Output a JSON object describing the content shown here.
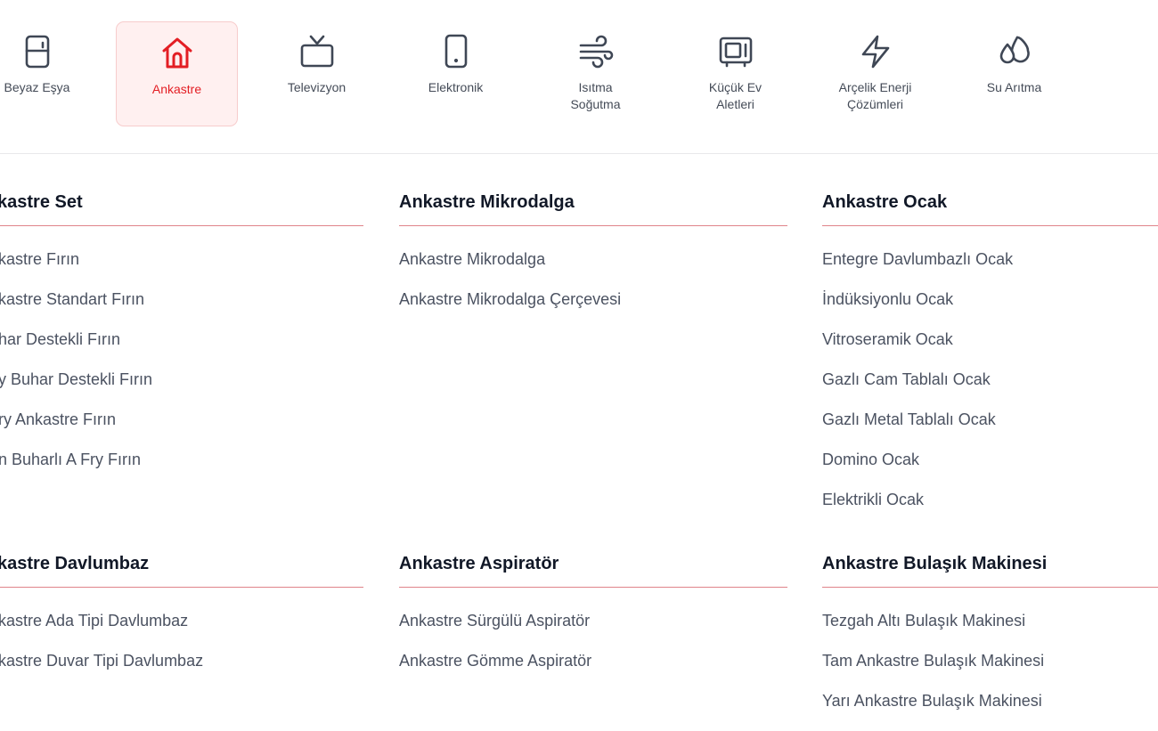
{
  "categories": [
    {
      "label": "Beyaz Eşya",
      "label2": "",
      "icon": "fridge-icon"
    },
    {
      "label": "Ankastre",
      "label2": "",
      "icon": "home-icon"
    },
    {
      "label": "Televizyon",
      "label2": "",
      "icon": "tv-icon"
    },
    {
      "label": "Elektronik",
      "label2": "",
      "icon": "phone-icon"
    },
    {
      "label": "Isıtma",
      "label2": "Soğutma",
      "icon": "wind-icon"
    },
    {
      "label": "Küçük Ev",
      "label2": "Aletleri",
      "icon": "microwave-icon"
    },
    {
      "label": "Arçelik Enerji",
      "label2": "Çözümleri",
      "icon": "lightning-icon"
    },
    {
      "label": "Su Arıtma",
      "label2": "",
      "icon": "water-drops-icon"
    }
  ],
  "active_category": "Ankastre",
  "accent_color": "#e31e24",
  "sections": [
    {
      "title": "kastre Set",
      "links": [
        "kastre Fırın",
        "kastre Standart Fırın",
        "har Destekli Fırın",
        "y Buhar Destekli Fırın",
        "ry Ankastre Fırın",
        "n Buharlı A Fry Fırın"
      ]
    },
    {
      "title": "Ankastre Mikrodalga",
      "links": [
        "Ankastre Mikrodalga",
        "Ankastre Mikrodalga Çerçevesi"
      ]
    },
    {
      "title": "Ankastre Ocak",
      "links": [
        "Entegre Davlumbazlı Ocak",
        "İndüksiyonlu Ocak",
        "Vitroseramik Ocak",
        "Gazlı Cam Tablalı Ocak",
        "Gazlı Metal Tablalı Ocak",
        "Domino Ocak",
        "Elektrikli Ocak"
      ]
    },
    {
      "title": "kastre Davlumbaz",
      "links": [
        "kastre Ada Tipi Davlumbaz",
        "kastre Duvar Tipi Davlumbaz"
      ]
    },
    {
      "title": "Ankastre Aspiratör",
      "links": [
        "Ankastre Sürgülü Aspiratör",
        "Ankastre Gömme Aspiratör"
      ]
    },
    {
      "title": "Ankastre Bulaşık Makinesi",
      "links": [
        "Tezgah Altı Bulaşık Makinesi",
        "Tam Ankastre Bulaşık Makinesi",
        "Yarı Ankastre Bulaşık Makinesi"
      ]
    }
  ]
}
